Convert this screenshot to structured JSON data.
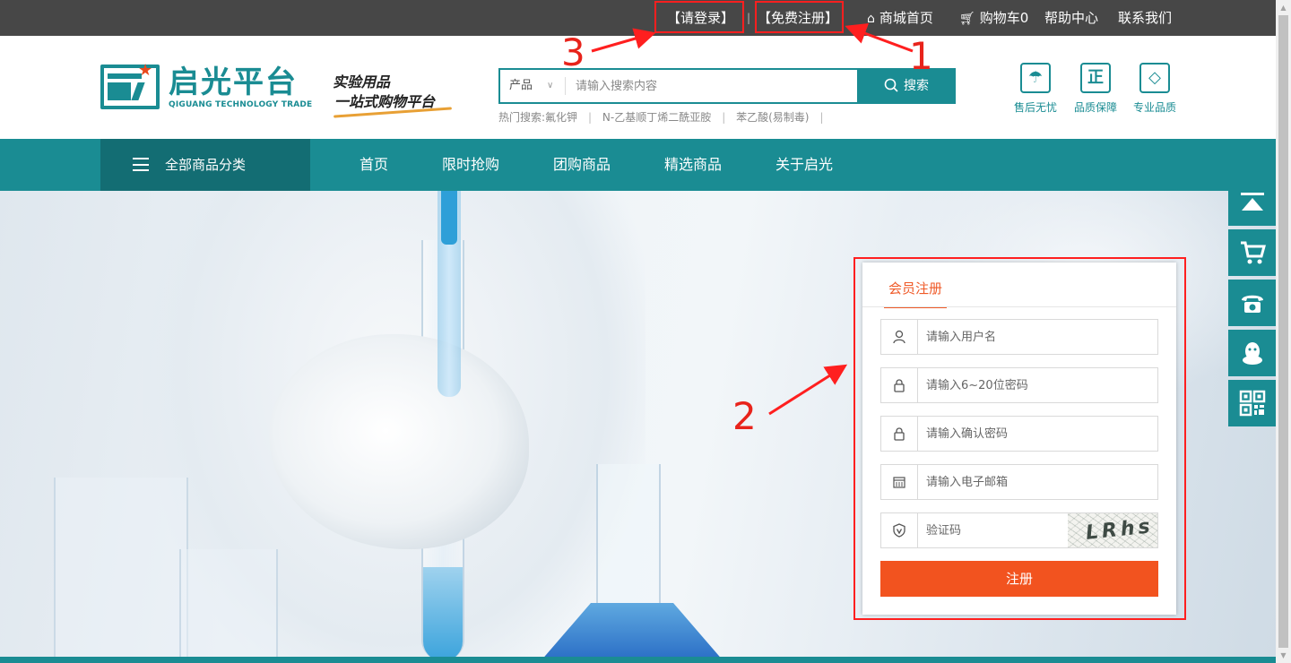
{
  "topbar": {
    "login": "【请登录】",
    "separator": "|",
    "register": "【免费注册】",
    "home": "商城首页",
    "cart": "购物车0",
    "help": "帮助中心",
    "contact": "联系我们"
  },
  "header": {
    "logo_name": "启光平台",
    "logo_en": "QIGUANG TECHNOLOGY TRADE",
    "slogan_line1": "实验用品",
    "slogan_line2": "一站式购物平台",
    "search": {
      "category": "产品",
      "placeholder": "请输入搜索内容",
      "button": "搜索"
    },
    "hot_searches": [
      "热门搜索:氟化钾",
      "N-乙基顺丁烯二酰亚胺",
      "苯乙酸(易制毒)"
    ],
    "guarantees": [
      {
        "icon": "umbrella-icon",
        "glyph": "☂",
        "label": "售后无忧"
      },
      {
        "icon": "zheng-icon",
        "glyph": "正",
        "label": "品质保障"
      },
      {
        "icon": "diamond-icon",
        "glyph": "◇",
        "label": "专业品质"
      }
    ]
  },
  "nav": {
    "all_categories": "全部商品分类",
    "links": [
      "首页",
      "限时抢购",
      "团购商品",
      "精选商品",
      "关于启光"
    ]
  },
  "register_form": {
    "tab": "会员注册",
    "username_placeholder": "请输入用户名",
    "password_placeholder": "请输入6~20位密码",
    "confirm_placeholder": "请输入确认密码",
    "email_placeholder": "请输入电子邮箱",
    "captcha_placeholder": "验证码",
    "captcha_text": "LRhs",
    "submit": "注册"
  },
  "annotations": [
    "1",
    "2",
    "3"
  ],
  "colors": {
    "brand_teal": "#1a8c93",
    "nav_dark": "#136d73",
    "accent_orange": "#f2531f",
    "annotation_red": "#ff1f1f",
    "topbar": "#474747"
  }
}
